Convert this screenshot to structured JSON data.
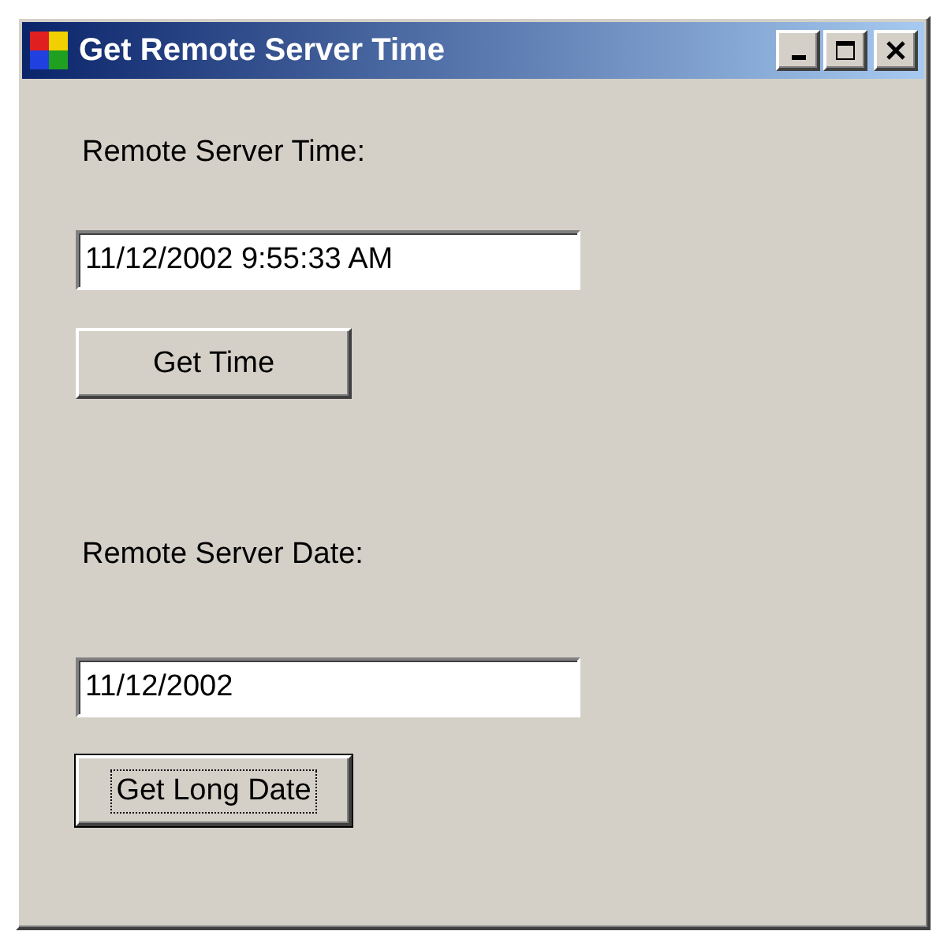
{
  "window": {
    "title": "Get Remote Server Time"
  },
  "controls": [
    {
      "kind": "label",
      "text": "Remote Server Time:"
    },
    {
      "kind": "textbox",
      "value": "11/12/2002 9:55:33 AM"
    },
    {
      "kind": "button",
      "text": "Get Time",
      "focused": false
    },
    {
      "kind": "label",
      "text": "Remote Server Date:"
    },
    {
      "kind": "textbox",
      "value": "11/12/2002"
    },
    {
      "kind": "button",
      "text": "Get Long Date",
      "focused": true
    }
  ]
}
